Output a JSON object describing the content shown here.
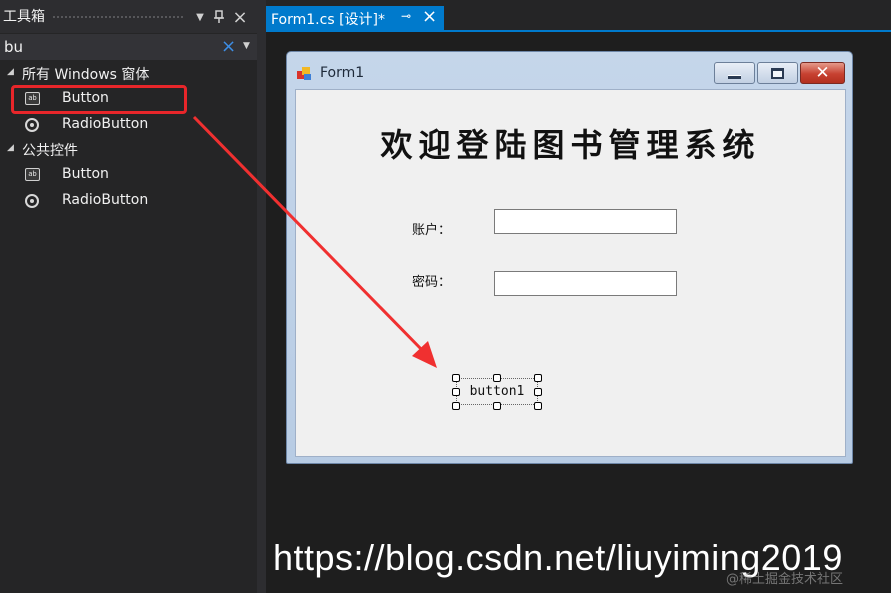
{
  "toolbox": {
    "title": "工具箱",
    "search": {
      "value": "bu"
    },
    "groups": [
      {
        "label": "所有 Windows 窗体",
        "items": [
          {
            "label": "Button",
            "icon": "button-tool-icon",
            "icon_text": "ab"
          },
          {
            "label": "RadioButton",
            "icon": "radiobutton-tool-icon"
          }
        ]
      },
      {
        "label": "公共控件",
        "items": [
          {
            "label": "Button",
            "icon": "button-tool-icon",
            "icon_text": "ab"
          },
          {
            "label": "RadioButton",
            "icon": "radiobutton-tool-icon"
          }
        ]
      }
    ]
  },
  "document_tab": {
    "label": "Form1.cs [设计]*"
  },
  "form": {
    "title": "Form1",
    "heading": "欢迎登陆图书管理系统",
    "account_label": "账户：",
    "password_label": "密码：",
    "account_value": "",
    "password_value": "",
    "button_text": "button1"
  },
  "watermark": {
    "url": "https://blog.csdn.net/liuyiming2019",
    "community": "@稀土掘金技术社区"
  },
  "colors": {
    "accent": "#007acc",
    "highlight": "#e8262a",
    "search_clear": "#3d8ee6",
    "close_button": "#c74131"
  }
}
